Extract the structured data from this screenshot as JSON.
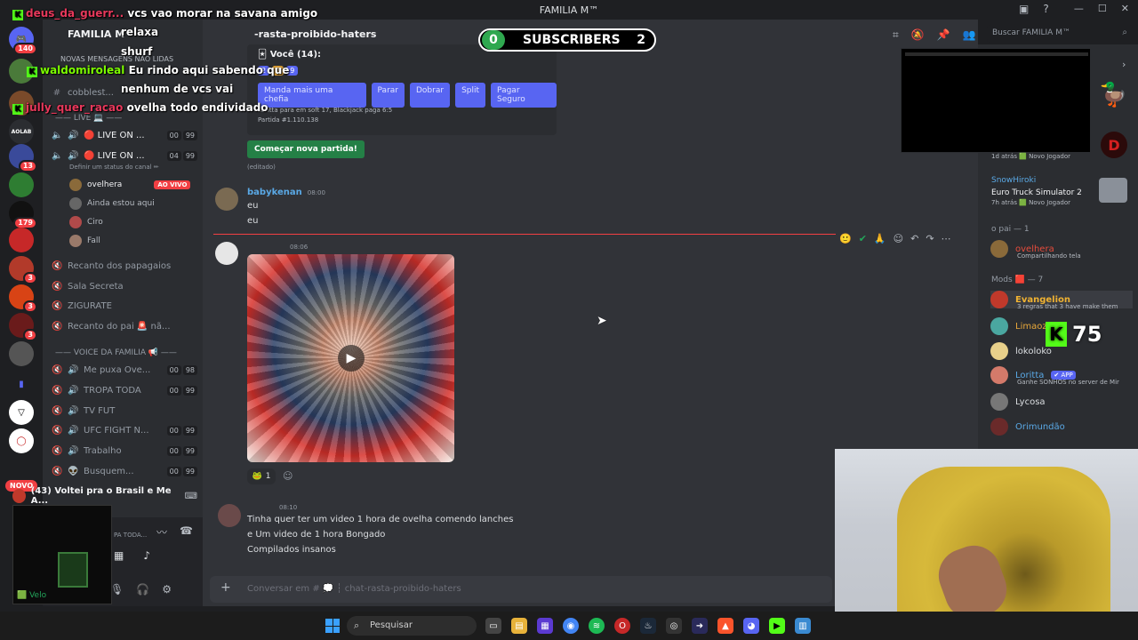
{
  "window": {
    "title": "FAMILIA M™"
  },
  "server": {
    "name": "FAMILIA M™",
    "unread_banner": "NOVAS MENSAGENS NÃO LIDAS",
    "rail_badges": [
      "140",
      "13",
      "179",
      "3",
      "3",
      "3"
    ],
    "novo_label": "NOVO"
  },
  "channels": {
    "cobblestone": "cobblest...",
    "category_live": "—— LIVE 💻 ——",
    "live1": {
      "name": "🔴 LIVE ON ...",
      "count_a": "00",
      "count_b": "99"
    },
    "live2": {
      "name": "🔴 LIVE ON ...",
      "count_a": "04",
      "count_b": "99"
    },
    "status_hint": "Definir um status do canal ✏",
    "voice_users": [
      {
        "name": "ovelhera",
        "badge": "AO VIVO"
      },
      {
        "name": "Ainda estou aqui"
      },
      {
        "name": "Ciro"
      },
      {
        "name": "Fall"
      }
    ],
    "recanto": "Recanto dos papagaios",
    "sala": "Sala Secreta",
    "zigurate": "ZIGURATE",
    "recanto_pai": "Recanto do pai 🚨 nã...",
    "category_voice": "—— VOICE DA FAMILIA 📢 ——",
    "me_puxa": {
      "name": "Me puxa Ove...",
      "count_a": "00",
      "count_b": "98"
    },
    "tropa": {
      "name": "TROPA TODA",
      "count_a": "00",
      "count_b": "99"
    },
    "tvfut": {
      "name": "TV FUT"
    },
    "ufc": {
      "name": "UFC FIGHT N...",
      "count_a": "00",
      "count_b": "99"
    },
    "trabalho": {
      "name": "Trabalho",
      "count_a": "00",
      "count_b": "99"
    },
    "busquem": {
      "name": "Busquem...",
      "count_a": "00",
      "count_b": "99"
    }
  },
  "activity_card": {
    "title": "(43) Voltei pra o Brasil e Me A..."
  },
  "user_panel": {
    "status_label": "Velo",
    "partial_text": "PA TODA..."
  },
  "overlay_chat": [
    {
      "name": "deus_da_guerr...",
      "text": "vcs vao morar na savana amigo"
    },
    {
      "name": "",
      "text": "relaxa"
    },
    {
      "name": "",
      "text": "shurf"
    },
    {
      "name": "waldomiroleal",
      "text": "Eu rindo aqui sabendo que"
    },
    {
      "name": "",
      "text": "nenhum de vcs vai"
    },
    {
      "name": "jully_quer_racao",
      "text": "ovelha todo endividado"
    }
  ],
  "main": {
    "channel_title": "-rasta-proibido-haters",
    "search_placeholder": "Buscar FAMILIA M™",
    "embed": {
      "you_label": "Você (14):",
      "cards": [
        "2",
        "3",
        "9"
      ],
      "buttons": [
        "Manda mais uma chefia",
        "Parar",
        "Dobrar",
        "Split",
        "Pagar Seguro"
      ],
      "footer1": "Loritta para em soft 17, Blackjack paga 6:5",
      "footer2": "Partida #1.110.138"
    },
    "new_game_button": "Começar nova partida!",
    "edited_label": "(editado)",
    "messages": [
      {
        "author": "babykenan",
        "time": "08:00",
        "lines": [
          "eu",
          "eu"
        ]
      },
      {
        "author": "",
        "time": "08:06",
        "lines": []
      },
      {
        "author": "",
        "time": "08:10",
        "lines": [
          "Tinha quer ter um video 1 hora de ovelha comendo lanches",
          "e Um video de 1 hora Bongado",
          "Compilados insanos"
        ]
      }
    ],
    "reaction_count": "1",
    "composer_placeholder": "Conversar em # 💭 ┆ chat-rasta-proibido-haters"
  },
  "overlay": {
    "subscribers_left": "0",
    "subscribers_label": "SUBSCRIBERS",
    "subscribers_right": "2",
    "kick_count": "75"
  },
  "members": {
    "activities": [
      {
        "title": "",
        "sub": "1d atrás  🟩 Novo Jogador"
      },
      {
        "title": "SnowHiroki",
        "sub": ""
      },
      {
        "title": "Euro Truck Simulator 2",
        "sub": "7h atrás  🟩 Novo Jogador"
      }
    ],
    "group_pai": "o pai — 1",
    "pai_member": {
      "name": "ovelhera",
      "sub": "Compartilhando tela"
    },
    "group_mods": "Mods 🟥 — 7",
    "mods": [
      {
        "name": "Evangelion",
        "sub": "3 regras that 3 have make them",
        "color": "#f0b232"
      },
      {
        "name": "Limaozi...",
        "sub": "",
        "color": "#e8a83a"
      },
      {
        "name": "lokoloko",
        "sub": "",
        "color": "#dbdee1"
      },
      {
        "name": "Loritta",
        "badge": "✔ APP",
        "sub": "Ganhe SONHOS no server de Mir",
        "color": "#5aa9e6"
      },
      {
        "name": "Lycosa",
        "sub": "",
        "color": "#dbdee1"
      },
      {
        "name": "Orimundão",
        "sub": "",
        "color": "#5aa9e6"
      }
    ]
  },
  "taskbar": {
    "search_label": "Pesquisar"
  },
  "colors": {
    "accent": "#5865f2",
    "danger": "#f23f43",
    "success": "#248046",
    "kick_green": "#53fc18"
  }
}
